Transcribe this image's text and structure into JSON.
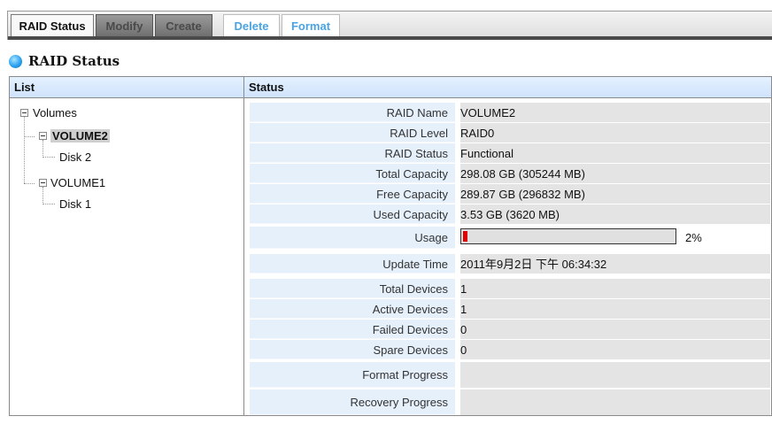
{
  "tabs": [
    {
      "label": "RAID Status",
      "state": "active"
    },
    {
      "label": "Modify",
      "state": "disabled"
    },
    {
      "label": "Create",
      "state": "disabled"
    },
    {
      "label": "Delete",
      "state": "enabled"
    },
    {
      "label": "Format",
      "state": "enabled"
    }
  ],
  "heading": {
    "title": "RAID Status",
    "icon": "status-dot-icon"
  },
  "table": {
    "list_header": "List",
    "status_header": "Status"
  },
  "tree": {
    "root": "Volumes",
    "volumes": [
      {
        "name": "VOLUME2",
        "selected": true,
        "disk": "Disk 2"
      },
      {
        "name": "VOLUME1",
        "selected": false,
        "disk": "Disk 1"
      }
    ]
  },
  "status": {
    "rows": [
      {
        "label": "RAID Name",
        "value": "VOLUME2"
      },
      {
        "label": "RAID Level",
        "value": "RAID0"
      },
      {
        "label": "RAID Status",
        "value": "Functional"
      },
      {
        "label": "Total Capacity",
        "value": "298.08 GB (305244 MB)"
      },
      {
        "label": "Free Capacity",
        "value": "289.87 GB (296832 MB)"
      },
      {
        "label": "Used Capacity",
        "value": "3.53 GB (3620 MB)"
      },
      {
        "label": "Usage",
        "value": "2%"
      },
      {
        "label": "Update Time",
        "value": "2011年9月2日 下午 06:34:32"
      },
      {
        "label": "Total Devices",
        "value": "1"
      },
      {
        "label": "Active Devices",
        "value": "1"
      },
      {
        "label": "Failed Devices",
        "value": "0"
      },
      {
        "label": "Spare Devices",
        "value": "0"
      },
      {
        "label": "Format Progress",
        "value": ""
      },
      {
        "label": "Recovery Progress",
        "value": ""
      }
    ],
    "usage_percent": 2,
    "usage_color": "#e00000"
  },
  "colors": {
    "accent": "#4aa3e0",
    "header_bg": "#cfe3fb",
    "label_bg": "#e6f0fb"
  }
}
